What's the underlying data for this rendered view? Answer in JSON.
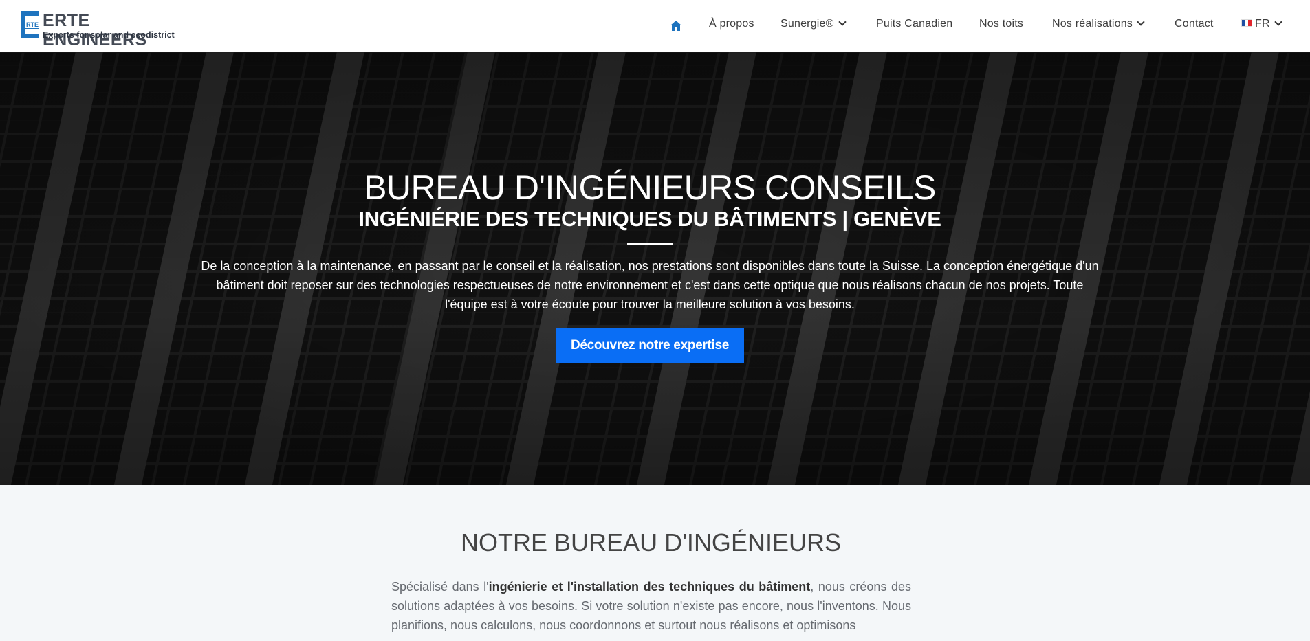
{
  "brand": {
    "logo_small": "RTE",
    "logo_title": "ERTE ENGINEERS",
    "logo_tagline": "Experts for solar and ecodistrict",
    "accent_color": "#1e73be"
  },
  "nav": {
    "home_icon": "home-icon",
    "items": [
      {
        "label": "À propos",
        "dropdown": false
      },
      {
        "label": "Sunergie®",
        "dropdown": true
      },
      {
        "label": "Puits Canadien",
        "dropdown": false
      },
      {
        "label": "Nos toits",
        "dropdown": false
      },
      {
        "label": "Nos réalisations",
        "dropdown": true
      },
      {
        "label": "Contact",
        "dropdown": false
      }
    ],
    "language": {
      "label": "FR",
      "flag_icon": "flag-fr-icon",
      "dropdown": true
    }
  },
  "hero": {
    "title": "BUREAU D'INGÉNIEURS CONSEILS",
    "subtitle": "INGÉNIÉRIE DES TECHNIQUES DU BÂTIMENTS | GENÈVE",
    "text": "De la conception à la maintenance, en passant par le conseil et la réalisation, nos prestations sont disponibles dans toute la Suisse. La conception énergétique d'un bâtiment doit reposer sur des technologies respectueuses de notre environnement et c'est dans cette optique que nous réalisons chacun de nos projets. Toute l'équipe est à votre écoute pour trouver la meilleure solution à vos besoins.",
    "button_label": "Découvrez notre expertise",
    "button_color": "#0a6ef5"
  },
  "about": {
    "title": "NOTRE BUREAU D'INGÉNIEURS",
    "text_before": "Spécialisé dans l'",
    "text_bold": "ingénierie et l'installation des techniques du bâtiment",
    "text_after": ", nous créons des solutions adaptées à vos besoins. Si votre solution n'existe pas encore, nous l'inventons. Nous planifions, nous calculons, nous coordonnons et surtout nous réalisons et optimisons"
  }
}
